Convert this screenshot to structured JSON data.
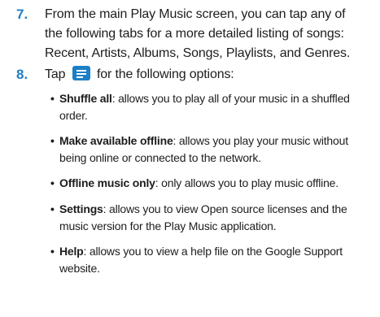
{
  "step7": {
    "number": "7.",
    "line1": "From the main Play Music screen, you can tap any of",
    "line2": "the following tabs for a more detailed listing of songs:",
    "line3": "Recent, Artists, Albums, Songs, Playlists, and Genres."
  },
  "step8": {
    "number": "8.",
    "text_before": "Tap",
    "text_after": "for the following options:",
    "icon": "menu-icon"
  },
  "bullets": [
    {
      "term": "Shuffle all",
      "line1": ": allows you to play all of your music in a shuffled",
      "line2": "order."
    },
    {
      "term": "Make available offline",
      "line1": ": allows you play your music without",
      "line2": "being online or connected to the network."
    },
    {
      "term": "Offline music only",
      "line1": ": only allows you to play music offline.",
      "line2": ""
    },
    {
      "term": "Settings",
      "line1": ": allows you to view Open source licenses and the",
      "line2": "music version for the Play Music application."
    },
    {
      "term": "Help",
      "line1": ": allows you to view a help file on the Google Support",
      "line2": "website."
    }
  ],
  "bullet_symbol": "•",
  "colors": {
    "accent": "#1c7fc6",
    "text": "#1d1d1d"
  }
}
